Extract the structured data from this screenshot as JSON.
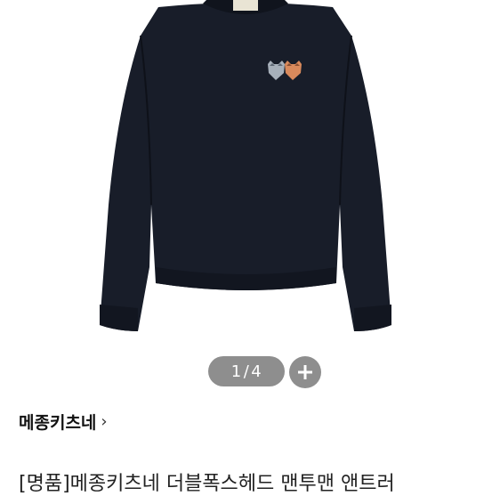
{
  "product": {
    "image_alt": "sweatshirt-photo",
    "colors": {
      "garment": "#181d29",
      "indicator_bg": "#8e8e8e"
    }
  },
  "gallery": {
    "current": "1",
    "separator": "/",
    "total": "4",
    "more_icon": "plus-icon"
  },
  "brand": {
    "name": "메종키츠네",
    "chevron": "›"
  },
  "title": "[명품]메종키츠네 더블폭스헤드 맨투맨 앤트러"
}
